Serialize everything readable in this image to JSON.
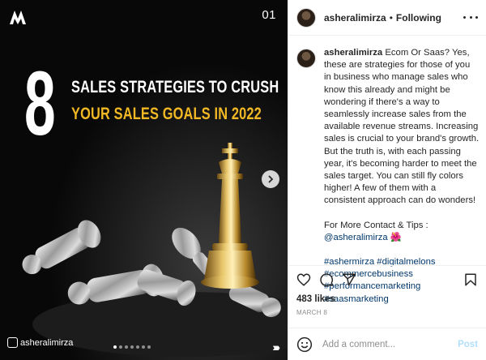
{
  "media": {
    "slide_number": "01",
    "big_number": "8",
    "headline_line1": "SALES STRATEGIES TO CRUSH",
    "headline_line2": "YOUR SALES GOALS IN 2022",
    "watermark": "asheralimirza",
    "carousel_dot_count": 7,
    "carousel_active_index": 0,
    "swipe_chevrons": "››››",
    "headline_accent_color": "#f1b824",
    "background_color": "#080808",
    "logo_icon": "brand-monogram-icon",
    "next_icon": "chevron-right-icon"
  },
  "header": {
    "username": "asheralimirza",
    "separator": "•",
    "follow_status": "Following",
    "more_icon": "more-options-icon"
  },
  "caption": {
    "username": "asheralimirza",
    "body": "Ecom Or Saas? Yes, these are strategies for those of you in business who manage sales who know this already and might be wondering if there's a way to seamlessly increase sales from the available revenue streams. Increasing sales is crucial to your brand's growth. But the truth is, with each passing year, it's becoming harder to meet the sales target. You can still fly colors higher! A few of them with a consistent approach can do wonders!",
    "contact_label": "For More Contact & Tips :",
    "mention": "@asheralimirza",
    "mention_emoji": "🌺",
    "hashtags_line1": [
      "#ashermirza",
      "#digitalmelons"
    ],
    "hashtags_line2": [
      "#ecommercebusiness"
    ],
    "hashtags_line3": [
      "#performancemarketing",
      "#saasmarketing"
    ]
  },
  "actions": {
    "like_icon": "heart-icon",
    "comment_icon": "comment-icon",
    "share_icon": "share-icon",
    "save_icon": "bookmark-icon"
  },
  "stats": {
    "likes": "483 likes",
    "date": "MARCH 8"
  },
  "comment": {
    "placeholder": "Add a comment...",
    "post_label": "Post",
    "emoji_icon": "emoji-icon"
  }
}
